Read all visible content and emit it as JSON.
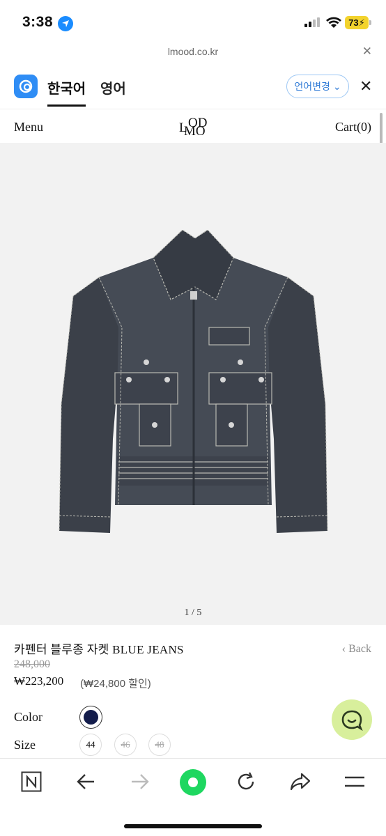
{
  "status": {
    "time": "3:38",
    "battery": "73",
    "icons": [
      "location-arrow-icon",
      "signal-icon",
      "wifi-icon",
      "battery-charging-icon"
    ]
  },
  "browser": {
    "url": "lmood.co.kr",
    "close_icon": "close-icon"
  },
  "translate_bar": {
    "tabs": [
      {
        "label": "한국어",
        "active": true
      },
      {
        "label": "영어",
        "active": false
      }
    ],
    "change_language": "언어변경",
    "close_icon": "close-icon"
  },
  "shop_header": {
    "menu": "Menu",
    "logo": [
      "L",
      "OD",
      "MO"
    ],
    "cart": "Cart(0)"
  },
  "gallery": {
    "counter": "1 / 5"
  },
  "product": {
    "name": "카펜터 블루종 자켓 BLUE JEANS",
    "back": "‹ Back",
    "original_price": "248,000",
    "price": "₩223,200",
    "discount": "(₩24,800 할인)",
    "color_label": "Color",
    "color_swatch": "#131c4b",
    "size_label": "Size",
    "sizes": [
      {
        "label": "44",
        "available": true
      },
      {
        "label": "46",
        "available": false
      },
      {
        "label": "48",
        "available": false
      }
    ]
  },
  "toolbar": [
    "naver-home-icon",
    "back-arrow-icon",
    "forward-arrow-icon",
    "green-dot-icon",
    "reload-icon",
    "share-icon",
    "hamburger-menu-icon"
  ],
  "colors": {
    "accent_blue": "#2f8df5",
    "chat_bg": "#d8ef9c",
    "green": "#1ed760"
  }
}
